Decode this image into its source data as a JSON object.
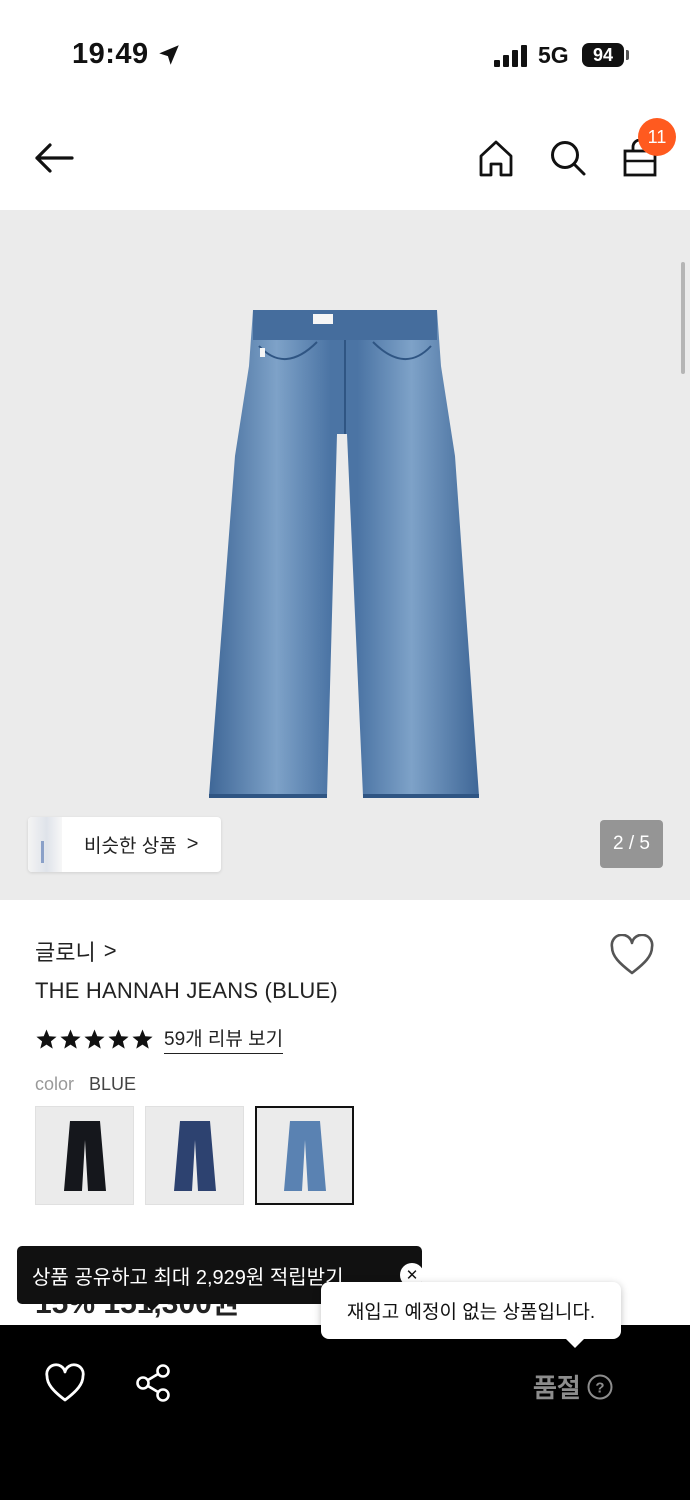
{
  "status_bar": {
    "time": "19:49",
    "network": "5G",
    "battery": "94"
  },
  "header": {
    "cart_count": "11",
    "icons": [
      "arrow-left-icon",
      "home-icon",
      "search-icon",
      "shopping-bag-icon"
    ],
    "badge_color": "#ff5a1f"
  },
  "gallery": {
    "similar_label": "비슷한 상품",
    "similar_chevron": ">",
    "counter": "2 / 5",
    "background": "#ebebeb"
  },
  "product": {
    "brand": "글로니",
    "brand_chevron": ">",
    "name": "THE HANNAH JEANS (BLUE)",
    "rating_stars": 5,
    "review_link": "59개 리뷰 보기",
    "color_key": "color",
    "color_value": "BLUE",
    "swatch_colors": [
      "BLACK",
      "INDIGO",
      "BLUE"
    ],
    "selected_swatch": "BLUE",
    "price_partial": "15% 151,300원"
  },
  "share_tooltip": {
    "text": "상품 공유하고 최대 2,929원 적립받기",
    "close": "✕"
  },
  "restock_tooltip": {
    "text": "재입고 예정이 없는 상품입니다."
  },
  "bottom_bar": {
    "status_label": "품절",
    "help": "?",
    "icons": [
      "heart-icon",
      "share-icon"
    ]
  }
}
